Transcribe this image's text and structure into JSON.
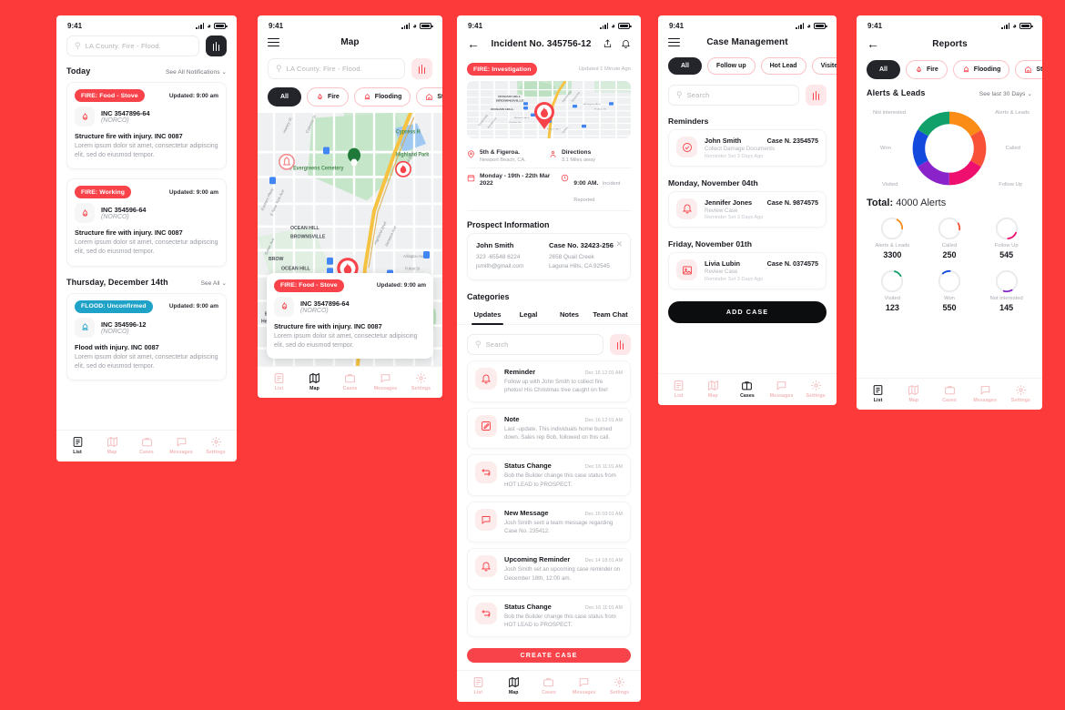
{
  "background_color": "#FC3A3A",
  "accent_red": "#F9434B",
  "status_bar": {
    "time": "9:41"
  },
  "screen_list": {
    "search": {
      "placeholder": "LA County. Fire - Flood.",
      "filter_icon": "sliders-icon"
    },
    "sections": [
      {
        "title": "Today",
        "link": "See All Notifications"
      },
      {
        "title": "Thursday, December 14th",
        "link": "See All"
      }
    ],
    "cards": [
      {
        "badge": "FIRE: Food - Stove",
        "badge_type": "fire",
        "updated": "Updated: 9:00 am",
        "icon": "fire-icon",
        "inc_no": "INC 3547896-64",
        "inc_sub": "(NORCO)",
        "title": "Structure fire with injury. INC 0087",
        "desc": "Lorem ipsum dolor sit amet, consectetur adipiscing elit, sed do eiusmod tempor."
      },
      {
        "badge": "FIRE: Working",
        "badge_type": "fire",
        "updated": "Updated: 9:00 am",
        "icon": "fire-icon",
        "inc_no": "INC 354596-64",
        "inc_sub": "(NORCO)",
        "title": "Structure fire with injury. INC 0087",
        "desc": "Lorem ipsum dolor sit amet, consectetur adipiscing elit, sed do eiusmod tempor."
      },
      {
        "badge": "FLOOD: Unconfirmed",
        "badge_type": "flood",
        "updated": "Updated: 9:00 am",
        "icon": "flood-icon",
        "inc_no": "INC 354596-12",
        "inc_sub": "(NORCO)",
        "title": "Flood with injury. INC 0087",
        "desc": "Lorem ipsum dolor sit amet, consectetur adipiscing elit, sed do eiusmod tempor."
      }
    ],
    "tabs": [
      {
        "label": "List",
        "icon": "list-icon",
        "active": true
      },
      {
        "label": "Map",
        "icon": "map-icon",
        "active": false
      },
      {
        "label": "Cases",
        "icon": "briefcase-icon",
        "active": false
      },
      {
        "label": "Messages",
        "icon": "message-icon",
        "active": false
      },
      {
        "label": "Settings",
        "icon": "gear-icon",
        "active": false
      }
    ]
  },
  "screen_map": {
    "title": "Map",
    "search": {
      "placeholder": "LA County. Fire - Flood."
    },
    "chips": [
      {
        "label": "All",
        "active": true
      },
      {
        "label": "Fire",
        "icon": "fire-icon",
        "active": false
      },
      {
        "label": "Flooding",
        "icon": "flood-icon",
        "active": false
      },
      {
        "label": "Structural",
        "icon": "house-icon",
        "active": false
      }
    ],
    "map_labels": [
      "The Evergreens Cemetery",
      "OCEAN HILL",
      "OCEAN HILL BROWNSVILLE",
      "Cypress H",
      "Highland Park",
      "Linden Park",
      "Atlantic Ave",
      "Pacific St",
      "BROW",
      "Be Head"
    ],
    "popup": {
      "badge": "FIRE: Food - Stove",
      "updated": "Updated: 9:00 am",
      "inc_no": "INC 3547896-64",
      "inc_sub": "(NORCO)",
      "title": "Structure fire with injury. INC 0087",
      "desc": "Lorem ipsum dolor sit amet, consectetur adipiscing elit, sed do eiusmod tempor."
    },
    "tabs": [
      {
        "label": "List",
        "active": false
      },
      {
        "label": "Map",
        "active": true
      },
      {
        "label": "Cases",
        "active": false
      },
      {
        "label": "Messages",
        "active": false
      },
      {
        "label": "Settings",
        "active": false
      }
    ]
  },
  "screen_incident": {
    "title": "Incident No. 345756-12",
    "share_icon": "share-icon",
    "bell_icon": "bell-icon",
    "badge": "FIRE: Investigation",
    "updated": "Updated 1 Minute Ago",
    "map_labels": [
      "OCEAN HILL BROWNSVILLE",
      "OCEAN HILL",
      "Atlantic Ave",
      "Pacific St",
      "Arlington Ave",
      "Fulton St"
    ],
    "meta": [
      {
        "icon": "location-icon",
        "label": "5th & Figeroa.",
        "sub": "Newport Beach, CA."
      },
      {
        "icon": "person-icon",
        "label": "Directions",
        "sub": "3.1 Miles away"
      },
      {
        "icon": "calendar-icon",
        "label": "Monday - 19th - 22th Mar 2022",
        "sub": ""
      },
      {
        "icon": "clock-icon",
        "label": "9:00 AM.",
        "sub": "Incident Reported"
      }
    ],
    "prospect_heading": "Prospect Information",
    "prospect": {
      "name": "John Smith",
      "case_no": "Case No. 32423-256",
      "phone": "323 -65548 6224",
      "email": "jsmith@gmail.com",
      "address_1": "2658 Quail Creek",
      "address_2": "Laguna Hills, CA 92545",
      "close_icon": "close-icon"
    },
    "categories_heading": "Categories",
    "tabs": [
      {
        "label": "Updates",
        "active": true
      },
      {
        "label": "Legal",
        "active": false
      },
      {
        "label": "Notes",
        "active": false
      },
      {
        "label": "Team Chat",
        "active": false
      }
    ],
    "search": {
      "placeholder": "Search"
    },
    "feed": [
      {
        "icon": "bell-icon",
        "title": "Reminder",
        "date": "Dec 16 12:01 AM",
        "desc": "Follow up with John Smith to collect fire photos! His Christmas tree caught on fire!"
      },
      {
        "icon": "note-icon",
        "title": "Note",
        "date": "Dec 16 12:01 AM",
        "desc": "Last -update. This individuals home burned down. Sales rep Bob, followed on this call."
      },
      {
        "icon": "status-icon",
        "title": "Status Change",
        "date": "Dec 16 11:01 AM",
        "desc": "Bob the Builder change this case status from HOT LEAD to PROSPECT."
      },
      {
        "icon": "message-icon",
        "title": "New Message",
        "date": "Dec 15 09:01 AM",
        "desc": "Josh Smith sent a team message regarding Case No. 235412."
      },
      {
        "icon": "bell-icon",
        "title": "Upcoming Reminder",
        "date": "Dec 14 18:01 AM",
        "desc": "Josh Smith set an upcoming case reminder on December 18th, 12:00 am."
      },
      {
        "icon": "status-icon",
        "title": "Status Change",
        "date": "Dec 16 11:01 AM",
        "desc": "Bob the Builder change this case status from HOT LEAD to PROSPECT."
      }
    ],
    "cta": "CREATE CASE",
    "tabs_bottom": [
      {
        "label": "List",
        "active": false
      },
      {
        "label": "Map",
        "active": true
      },
      {
        "label": "Cases",
        "active": false
      },
      {
        "label": "Messages",
        "active": false
      },
      {
        "label": "Settings",
        "active": false
      }
    ]
  },
  "screen_cases": {
    "title": "Case Management",
    "chips": [
      {
        "label": "All",
        "active": true
      },
      {
        "label": "Follow up",
        "active": false
      },
      {
        "label": "Hot Lead",
        "active": false
      },
      {
        "label": "Visited",
        "active": false
      }
    ],
    "search": {
      "placeholder": "Search"
    },
    "groups": [
      {
        "heading": "Reminders",
        "items": [
          {
            "icon": "check-circle-icon",
            "name": "John Smith",
            "case": "Case N. 2354575",
            "sub": "Collect Damage Documents",
            "sub2": "Reminder Set 3 Days Ago"
          }
        ]
      },
      {
        "heading": "Monday, November 04th",
        "items": [
          {
            "icon": "bell-icon",
            "name": "Jennifer Jones",
            "case": "Case N. 9874575",
            "sub": "Review Case",
            "sub2": "Reminder Set 3 Days Ago"
          }
        ]
      },
      {
        "heading": "Friday, November 01th",
        "items": [
          {
            "icon": "photo-icon",
            "name": "Livia Lubin",
            "case": "Case N. 0374575",
            "sub": "Review Case",
            "sub2": "Reminder Set 3 Days Ago"
          }
        ]
      }
    ],
    "cta": "ADD CASE",
    "tabs": [
      {
        "label": "List",
        "active": false
      },
      {
        "label": "Map",
        "active": false
      },
      {
        "label": "Cases",
        "active": true
      },
      {
        "label": "Messages",
        "active": false
      },
      {
        "label": "Settings",
        "active": false
      }
    ]
  },
  "screen_reports": {
    "title": "Reports",
    "chips": [
      {
        "label": "All",
        "active": true
      },
      {
        "label": "Fire",
        "icon": "fire-icon",
        "active": false
      },
      {
        "label": "Flooding",
        "icon": "flood-icon",
        "active": false
      },
      {
        "label": "Structural",
        "icon": "house-icon",
        "active": false
      }
    ],
    "section_title": "Alerts & Leads",
    "section_link": "See last 30 Days",
    "total_label": "Total:",
    "total_value": "4000 Alerts",
    "tabs": [
      {
        "label": "List",
        "active": true
      },
      {
        "label": "Map",
        "active": false
      },
      {
        "label": "Cases",
        "active": false
      },
      {
        "label": "Messages",
        "active": false
      },
      {
        "label": "Settings",
        "active": false
      }
    ]
  },
  "chart_data": [
    {
      "type": "pie",
      "title": "Alerts & Leads",
      "subtitle": "Total: 4000 Alerts",
      "legend_position": "around",
      "labels": [
        "Alerts & Leads",
        "Called",
        "Follow Up",
        "Visited",
        "Won",
        "Not interested"
      ],
      "values": [
        3300,
        250,
        545,
        123,
        550,
        145
      ],
      "display_shares": [
        16.67,
        16.67,
        16.67,
        16.67,
        16.67,
        16.67
      ],
      "colors": [
        "#FB8C15",
        "#F95138",
        "#EE0F6E",
        "#8A23C9",
        "#1449DE",
        "#12A06A"
      ]
    },
    {
      "type": "bar",
      "title": "Stat rings",
      "categories": [
        "Alerts & Leads",
        "Called",
        "Follow Up",
        "Visited",
        "Won",
        "Not interested"
      ],
      "values": [
        3300,
        250,
        545,
        123,
        550,
        145
      ],
      "colors": [
        "#FB8C15",
        "#F95138",
        "#EE0F6E",
        "#12A06A",
        "#1449DE",
        "#8A23C9"
      ],
      "ring_fractions": [
        0.17,
        0.1,
        0.16,
        0.11,
        0.12,
        0.13
      ],
      "ring_start_deg": [
        300,
        55,
        95,
        285,
        230,
        150
      ]
    }
  ],
  "stats": [
    {
      "label": "Alerts & Leads",
      "value": "3300",
      "color": "#FB8C15"
    },
    {
      "label": "Called",
      "value": "250",
      "color": "#F95138"
    },
    {
      "label": "Follow Up",
      "value": "545",
      "color": "#EE0F6E"
    },
    {
      "label": "Visited",
      "value": "123",
      "color": "#12A06A"
    },
    {
      "label": "Won",
      "value": "550",
      "color": "#1449DE"
    },
    {
      "label": "Not interested",
      "value": "145",
      "color": "#8A23C9"
    }
  ],
  "donut_labels": [
    {
      "text": "Not interested",
      "pos": "tl"
    },
    {
      "text": "Alerts & Leads",
      "pos": "tr"
    },
    {
      "text": "Won",
      "pos": "l"
    },
    {
      "text": "Called",
      "pos": "r"
    },
    {
      "text": "Visited",
      "pos": "bl"
    },
    {
      "text": "Follow Up",
      "pos": "br"
    }
  ]
}
